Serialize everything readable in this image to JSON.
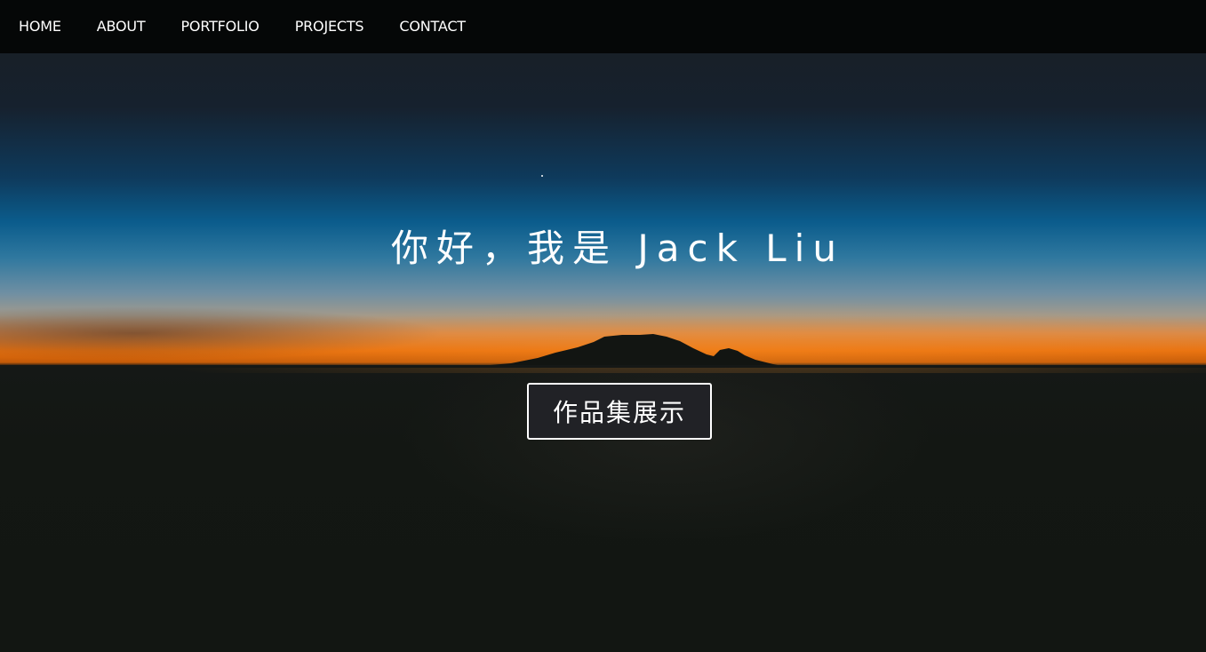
{
  "nav": {
    "items": [
      {
        "label": "HOME"
      },
      {
        "label": "ABOUT"
      },
      {
        "label": "PORTFOLIO"
      },
      {
        "label": "PROJECTS"
      },
      {
        "label": "CONTACT"
      }
    ]
  },
  "hero": {
    "title": "你好，我是 Jack Liu",
    "button_label": "作品集展示"
  },
  "colors": {
    "navbar": "#050707",
    "sky_top": "#16212e",
    "sky_blue": "#0b5c8c",
    "horizon_orange": "#e8710f",
    "ground": "#121612",
    "button_bg": "#212226",
    "text": "#ffffff"
  }
}
